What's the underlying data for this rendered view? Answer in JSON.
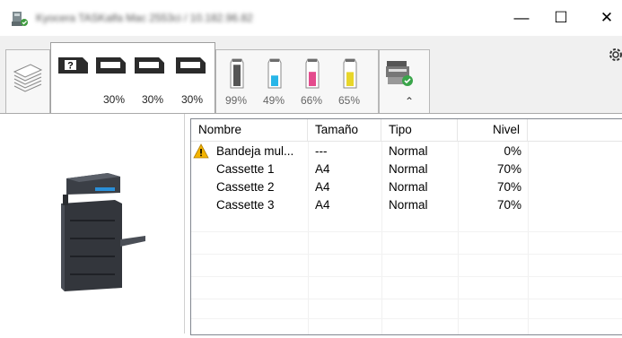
{
  "window": {
    "title": "Kyocera TASKalfa Mac 2553ci / 10.182.96.82",
    "minimize": "—",
    "maximize": "☐",
    "close": "✕"
  },
  "toolbar": {
    "paper_tab_percents": [
      "30%",
      "30%",
      "30%"
    ],
    "toner_tab_percents": [
      "99%",
      "49%",
      "66%",
      "65%"
    ],
    "toner_levels": [
      0.99,
      0.49,
      0.66,
      0.65
    ],
    "toner_colors": [
      "#555555",
      "#29b6e8",
      "#e44b8d",
      "#e8d62a"
    ],
    "expand_icon": "⌃",
    "settings_icon": "gear-icon"
  },
  "table": {
    "columns": [
      "Nombre",
      "Tamaño",
      "Tipo",
      "Nivel"
    ],
    "rows": [
      {
        "name": "Bandeja mul...",
        "size": "---",
        "type": "Normal",
        "level": "0%",
        "warning": true
      },
      {
        "name": "Cassette 1",
        "size": "A4",
        "type": "Normal",
        "level": "70%",
        "warning": false
      },
      {
        "name": "Cassette 2",
        "size": "A4",
        "type": "Normal",
        "level": "70%",
        "warning": false
      },
      {
        "name": "Cassette 3",
        "size": "A4",
        "type": "Normal",
        "level": "70%",
        "warning": false
      }
    ]
  },
  "colors": {
    "warning": "#f4b400",
    "accent_tray": "#2a8fd8"
  }
}
